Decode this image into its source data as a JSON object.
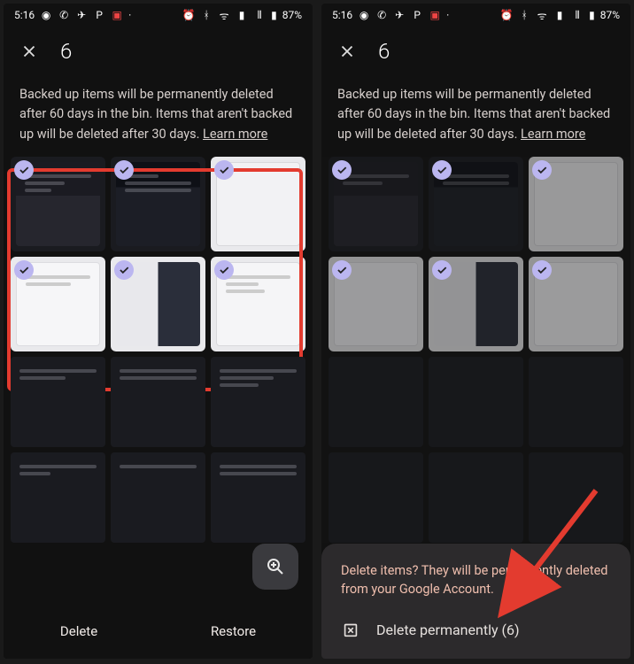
{
  "status": {
    "time": "5:16",
    "battery": "87%"
  },
  "header": {
    "count": "6"
  },
  "info": {
    "text_before": "Backed up items will be permanently deleted after 60 days in the bin. Items that aren't backed up will be deleted after 30 days. ",
    "learn_more": "Learn more"
  },
  "actions": {
    "delete": "Delete",
    "restore": "Restore"
  },
  "sheet": {
    "message": "Delete items? They will be permanently deleted from your Google Account.",
    "action_label": "Delete permanently (6)"
  },
  "thumbs": [
    {
      "class": "th-a dark2"
    },
    {
      "class": "th-b dark2"
    },
    {
      "class": "th-c light"
    },
    {
      "class": "th-d light"
    },
    {
      "class": "th-e light"
    },
    {
      "class": "th-f light"
    }
  ]
}
